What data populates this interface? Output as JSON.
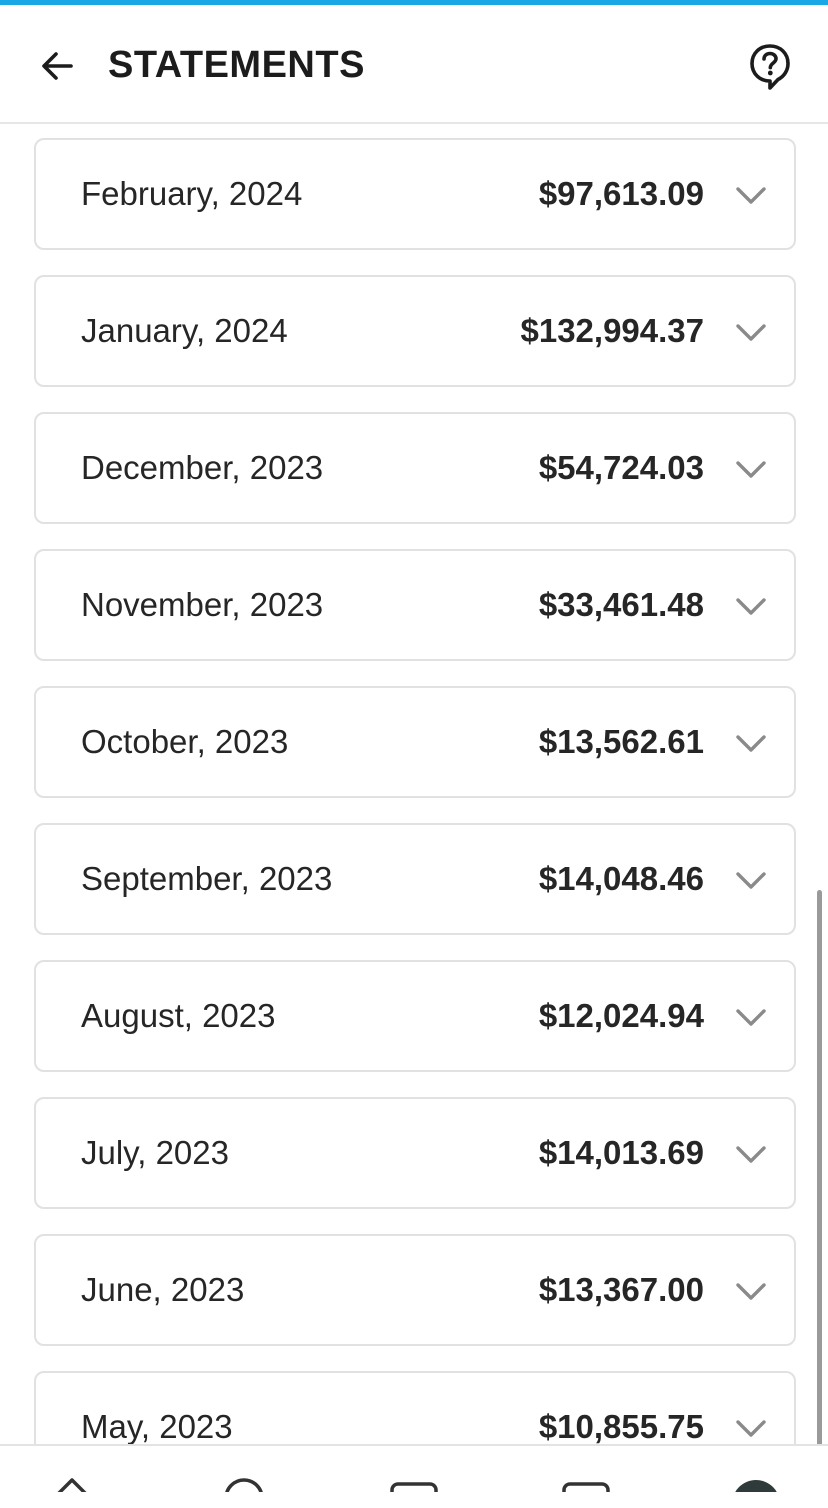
{
  "header": {
    "title": "STATEMENTS",
    "back_icon": "arrow-left-icon",
    "help_icon": "question-circle-icon"
  },
  "colors": {
    "accent": "#1aa7e6",
    "card_border": "#e1e1e1",
    "text": "#262626",
    "chevron": "#8a8a8a"
  },
  "statements": [
    {
      "date": "February, 2024",
      "amount": "$97,613.09"
    },
    {
      "date": "January, 2024",
      "amount": "$132,994.37"
    },
    {
      "date": "December, 2023",
      "amount": "$54,724.03"
    },
    {
      "date": "November, 2023",
      "amount": "$33,461.48"
    },
    {
      "date": "October, 2023",
      "amount": "$13,562.61"
    },
    {
      "date": "September, 2023",
      "amount": "$14,048.46"
    },
    {
      "date": "August, 2023",
      "amount": "$12,024.94"
    },
    {
      "date": "July, 2023",
      "amount": "$14,013.69"
    },
    {
      "date": "June, 2023",
      "amount": "$13,367.00"
    },
    {
      "date": "May, 2023",
      "amount": "$10,855.75"
    }
  ],
  "bottom_nav": [
    "home-icon",
    "search-icon",
    "card-icon",
    "wallet-icon",
    "avatar"
  ]
}
